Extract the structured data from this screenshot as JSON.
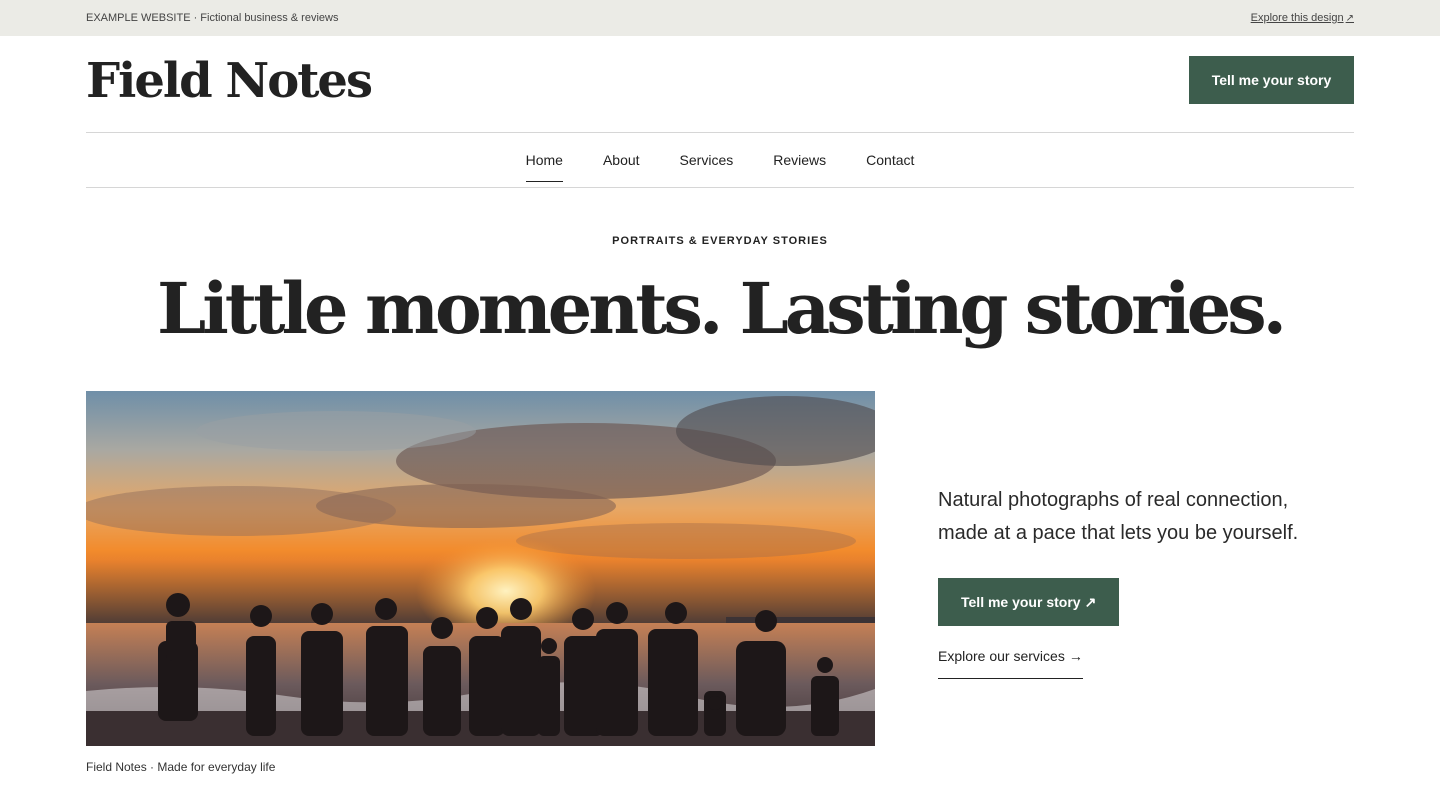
{
  "topbar": {
    "notice": "EXAMPLE WEBSITE · Fictional business & reviews",
    "explore_link": "Explore this design",
    "explore_icon": "arrow-up-right-icon"
  },
  "header": {
    "logo": "Field Notes",
    "cta_label": "Tell me your story"
  },
  "nav": {
    "items": [
      {
        "label": "Home",
        "active": true
      },
      {
        "label": "About",
        "active": false
      },
      {
        "label": "Services",
        "active": false
      },
      {
        "label": "Reviews",
        "active": false
      },
      {
        "label": "Contact",
        "active": false
      }
    ]
  },
  "hero": {
    "eyebrow": "PORTRAITS & EVERYDAY STORIES",
    "headline": "Little moments. Lasting stories.",
    "photo_caption": "Field Notes · Made for everyday life",
    "lede_line1": "Natural photographs of real connection,",
    "lede_line2": "made at a pace that lets you be yourself.",
    "cta_label": "Tell me your story",
    "cta_icon": "arrow-up-right-icon",
    "secondary_link": "Explore our services",
    "secondary_icon": "arrow-right-icon"
  },
  "colors": {
    "accent": "#3d5d4d",
    "topbar_bg": "#ebebe6",
    "text": "#222222"
  }
}
